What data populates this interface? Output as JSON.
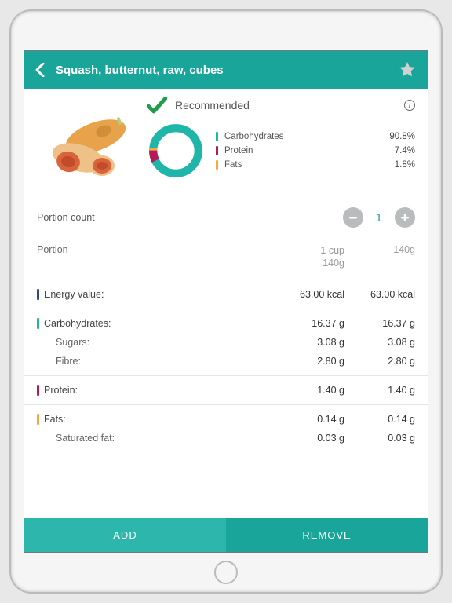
{
  "header": {
    "title": "Squash, butternut, raw, cubes"
  },
  "recommended": {
    "label": "Recommended"
  },
  "macros": {
    "items": [
      {
        "name": "Carbohydrates",
        "pct": "90.8%",
        "color": "#1fb6a9"
      },
      {
        "name": "Protein",
        "pct": "7.4%",
        "color": "#b51a57"
      },
      {
        "name": "Fats",
        "pct": "1.8%",
        "color": "#f4a93a"
      }
    ]
  },
  "portion": {
    "count_label": "Portion count",
    "count": "1",
    "label": "Portion",
    "unit_line1": "1 cup",
    "unit_line2": "140g",
    "total": "140g"
  },
  "nutrition": {
    "energy": {
      "label": "Energy value:",
      "per": "63.00 kcal",
      "total": "63.00 kcal"
    },
    "carbs": {
      "label": "Carbohydrates:",
      "per": "16.37 g",
      "total": "16.37 g",
      "sugars": {
        "label": "Sugars:",
        "per": "3.08 g",
        "total": "3.08 g"
      },
      "fibre": {
        "label": "Fibre:",
        "per": "2.80 g",
        "total": "2.80 g"
      }
    },
    "protein": {
      "label": "Protein:",
      "per": "1.40 g",
      "total": "1.40 g"
    },
    "fats": {
      "label": "Fats:",
      "per": "0.14 g",
      "total": "0.14 g",
      "sat": {
        "label": "Saturated fat:",
        "per": "0.03 g",
        "total": "0.03 g"
      }
    }
  },
  "footer": {
    "add": "ADD",
    "remove": "REMOVE"
  },
  "chart_data": {
    "type": "pie",
    "title": "",
    "categories": [
      "Carbohydrates",
      "Protein",
      "Fats"
    ],
    "values": [
      90.8,
      7.4,
      1.8
    ]
  }
}
